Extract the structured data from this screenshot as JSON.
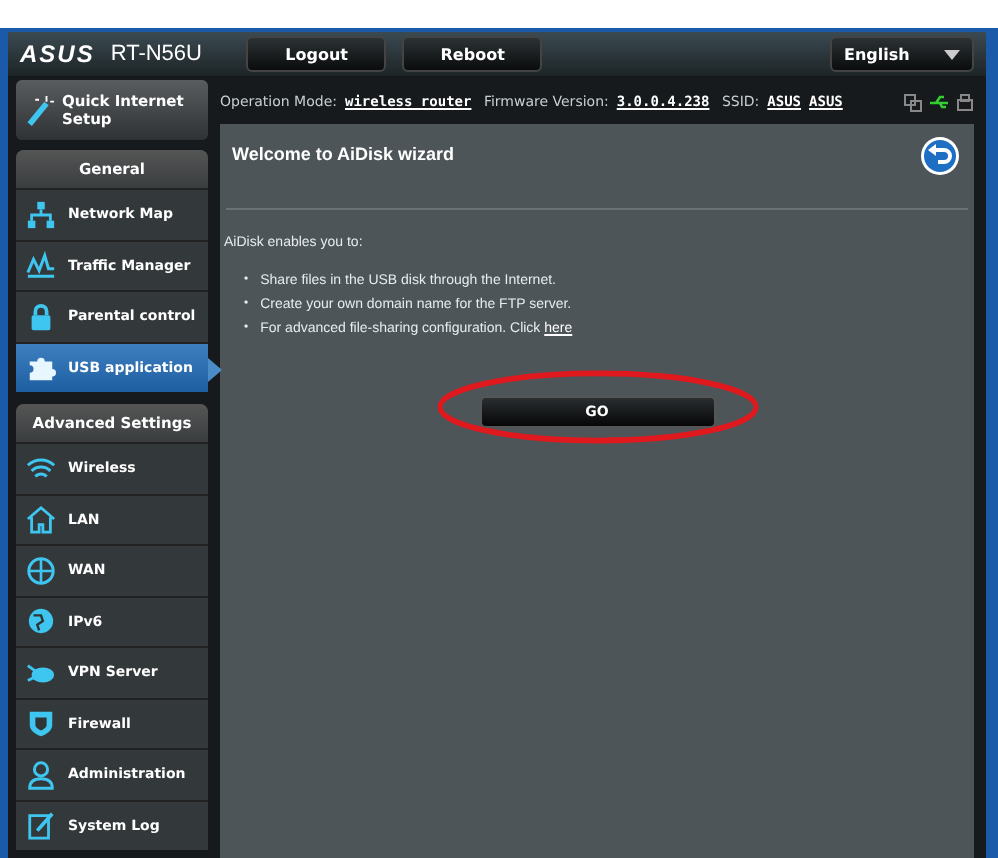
{
  "header": {
    "logo": "ASUS",
    "model": "RT-N56U",
    "buttons": [
      "Logout",
      "Reboot"
    ],
    "language": "English"
  },
  "status": {
    "mode_label": "Operation Mode:",
    "mode": "wireless router",
    "firmware_label": "Firmware Version:",
    "firmware": "3.0.0.4.238",
    "ssid_label": "SSID:",
    "ssids": [
      "ASUS",
      "ASUS"
    ]
  },
  "quick_setup": {
    "label": "Quick Internet Setup"
  },
  "sidebar": [
    {
      "heading": "General",
      "items": [
        {
          "label": "Network Map",
          "kind": "network",
          "selected": false
        },
        {
          "label": "Traffic Manager",
          "kind": "traffic",
          "selected": false
        },
        {
          "label": "Parental control",
          "kind": "lock",
          "selected": false
        },
        {
          "label": "USB application",
          "kind": "puzzle",
          "selected": true
        }
      ]
    },
    {
      "heading": "Advanced Settings",
      "items": [
        {
          "label": "Wireless",
          "kind": "wifi",
          "selected": false
        },
        {
          "label": "LAN",
          "kind": "house",
          "selected": false
        },
        {
          "label": "WAN",
          "kind": "globe",
          "selected": false
        },
        {
          "label": "IPv6",
          "kind": "globe2",
          "selected": false
        },
        {
          "label": "VPN Server",
          "kind": "vpn",
          "selected": false
        },
        {
          "label": "Firewall",
          "kind": "shield",
          "selected": false
        },
        {
          "label": "Administration",
          "kind": "person",
          "selected": false
        },
        {
          "label": "System Log",
          "kind": "note",
          "selected": false
        }
      ]
    }
  ],
  "panel": {
    "title": "Welcome to AiDisk wizard",
    "intro": "AiDisk enables you to:",
    "bullets": [
      "Share files in the USB disk through the Internet.",
      "Create your own domain name for the FTP server.",
      "For advanced file-sharing configuration. Click "
    ],
    "link": "here",
    "marker": "•",
    "go": "GO"
  }
}
